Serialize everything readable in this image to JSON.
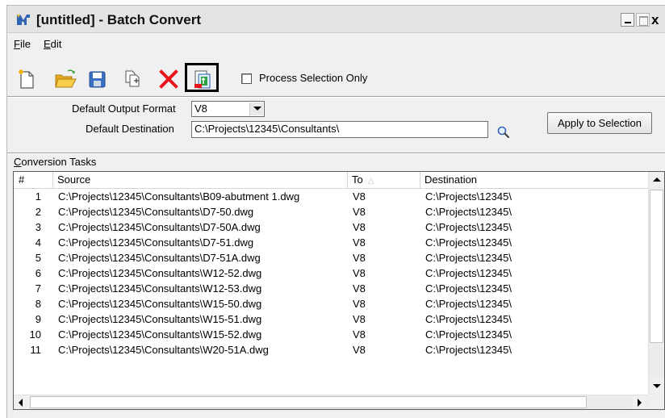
{
  "window": {
    "title": "[untitled] - Batch Convert",
    "icon": "microstation-icon",
    "controls": [
      "minimize",
      "maximize",
      "close"
    ],
    "close_label": "x"
  },
  "menu": {
    "file": {
      "mnemonic": "F",
      "rest": "ile"
    },
    "edit": {
      "mnemonic": "E",
      "rest": "dit"
    }
  },
  "toolbar": {
    "buttons": [
      "new-icon",
      "open-folder-icon",
      "save-icon",
      "add-files-icon",
      "delete-icon",
      "process-icon"
    ],
    "process_selection_only": {
      "label": "Process Selection Only",
      "checked": false
    }
  },
  "settings": {
    "default_output_format_label": "Default Output Format",
    "default_output_format_value": "V8",
    "default_destination_label": "Default Destination",
    "default_destination_value": "C:\\Projects\\12345\\Consultants\\",
    "apply_button": "Apply to Selection"
  },
  "tasks": {
    "title": {
      "mnemonic": "C",
      "rest": "onversion Tasks"
    },
    "columns": {
      "num": "#",
      "source": "Source",
      "to": "To",
      "destination": "Destination"
    },
    "rows": [
      {
        "num": "1",
        "source": "C:\\Projects\\12345\\Consultants\\B09-abutment 1.dwg",
        "to": "V8",
        "destination": "C:\\Projects\\12345\\"
      },
      {
        "num": "2",
        "source": "C:\\Projects\\12345\\Consultants\\D7-50.dwg",
        "to": "V8",
        "destination": "C:\\Projects\\12345\\"
      },
      {
        "num": "3",
        "source": "C:\\Projects\\12345\\Consultants\\D7-50A.dwg",
        "to": "V8",
        "destination": "C:\\Projects\\12345\\"
      },
      {
        "num": "4",
        "source": "C:\\Projects\\12345\\Consultants\\D7-51.dwg",
        "to": "V8",
        "destination": "C:\\Projects\\12345\\"
      },
      {
        "num": "5",
        "source": "C:\\Projects\\12345\\Consultants\\D7-51A.dwg",
        "to": "V8",
        "destination": "C:\\Projects\\12345\\"
      },
      {
        "num": "6",
        "source": "C:\\Projects\\12345\\Consultants\\W12-52.dwg",
        "to": "V8",
        "destination": "C:\\Projects\\12345\\"
      },
      {
        "num": "7",
        "source": "C:\\Projects\\12345\\Consultants\\W12-53.dwg",
        "to": "V8",
        "destination": "C:\\Projects\\12345\\"
      },
      {
        "num": "8",
        "source": "C:\\Projects\\12345\\Consultants\\W15-50.dwg",
        "to": "V8",
        "destination": "C:\\Projects\\12345\\"
      },
      {
        "num": "9",
        "source": "C:\\Projects\\12345\\Consultants\\W15-51.dwg",
        "to": "V8",
        "destination": "C:\\Projects\\12345\\"
      },
      {
        "num": "10",
        "source": "C:\\Projects\\12345\\Consultants\\W15-52.dwg",
        "to": "V8",
        "destination": "C:\\Projects\\12345\\"
      },
      {
        "num": "11",
        "source": "C:\\Projects\\12345\\Consultants\\W20-51A.dwg",
        "to": "V8",
        "destination": "C:\\Projects\\12345\\"
      }
    ]
  },
  "colors": {
    "window_bg": "#f0f0f0",
    "delete_red": "#e8161b",
    "folder_yellow": "#f2c233",
    "save_blue": "#3a6fc4",
    "process_green": "#2ea043"
  }
}
